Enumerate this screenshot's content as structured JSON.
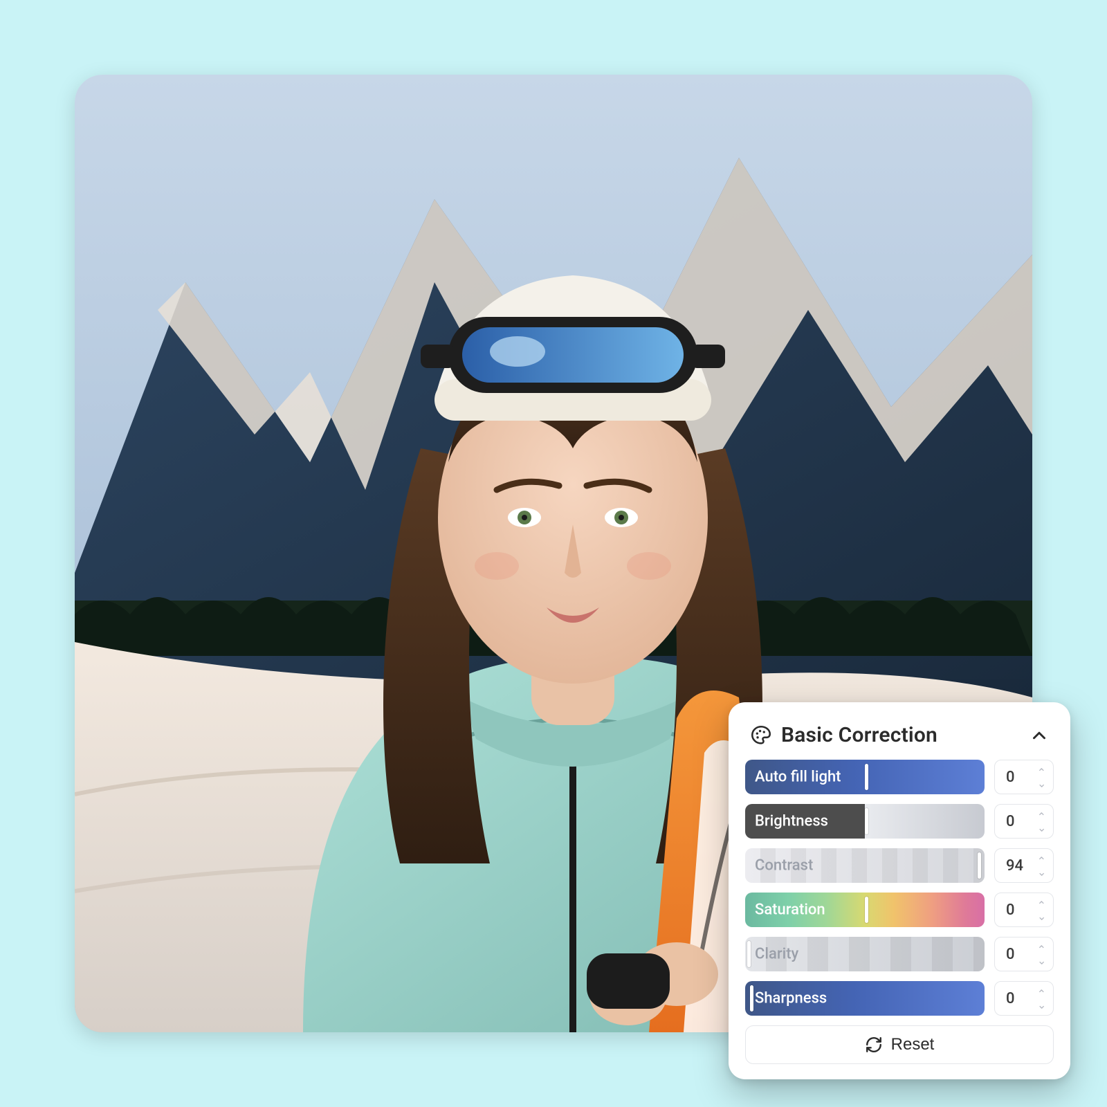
{
  "panel": {
    "title": "Basic Correction",
    "reset_label": "Reset",
    "controls": [
      {
        "key": "auto_fill_light",
        "label": "Auto fill light",
        "value": 0,
        "style": "blue",
        "handle_pct": 50
      },
      {
        "key": "brightness",
        "label": "Brightness",
        "value": 0,
        "style": "gray",
        "handle_pct": 50
      },
      {
        "key": "contrast",
        "label": "Contrast",
        "value": 94,
        "style": "corr",
        "handle_pct": 97
      },
      {
        "key": "saturation",
        "label": "Saturation",
        "value": 0,
        "style": "sat",
        "handle_pct": 50
      },
      {
        "key": "clarity",
        "label": "Clarity",
        "value": 0,
        "style": "clarity",
        "handle_pct": 0
      },
      {
        "key": "sharpness",
        "label": "Sharpness",
        "value": 0,
        "style": "blue",
        "handle_pct": 2
      }
    ]
  }
}
